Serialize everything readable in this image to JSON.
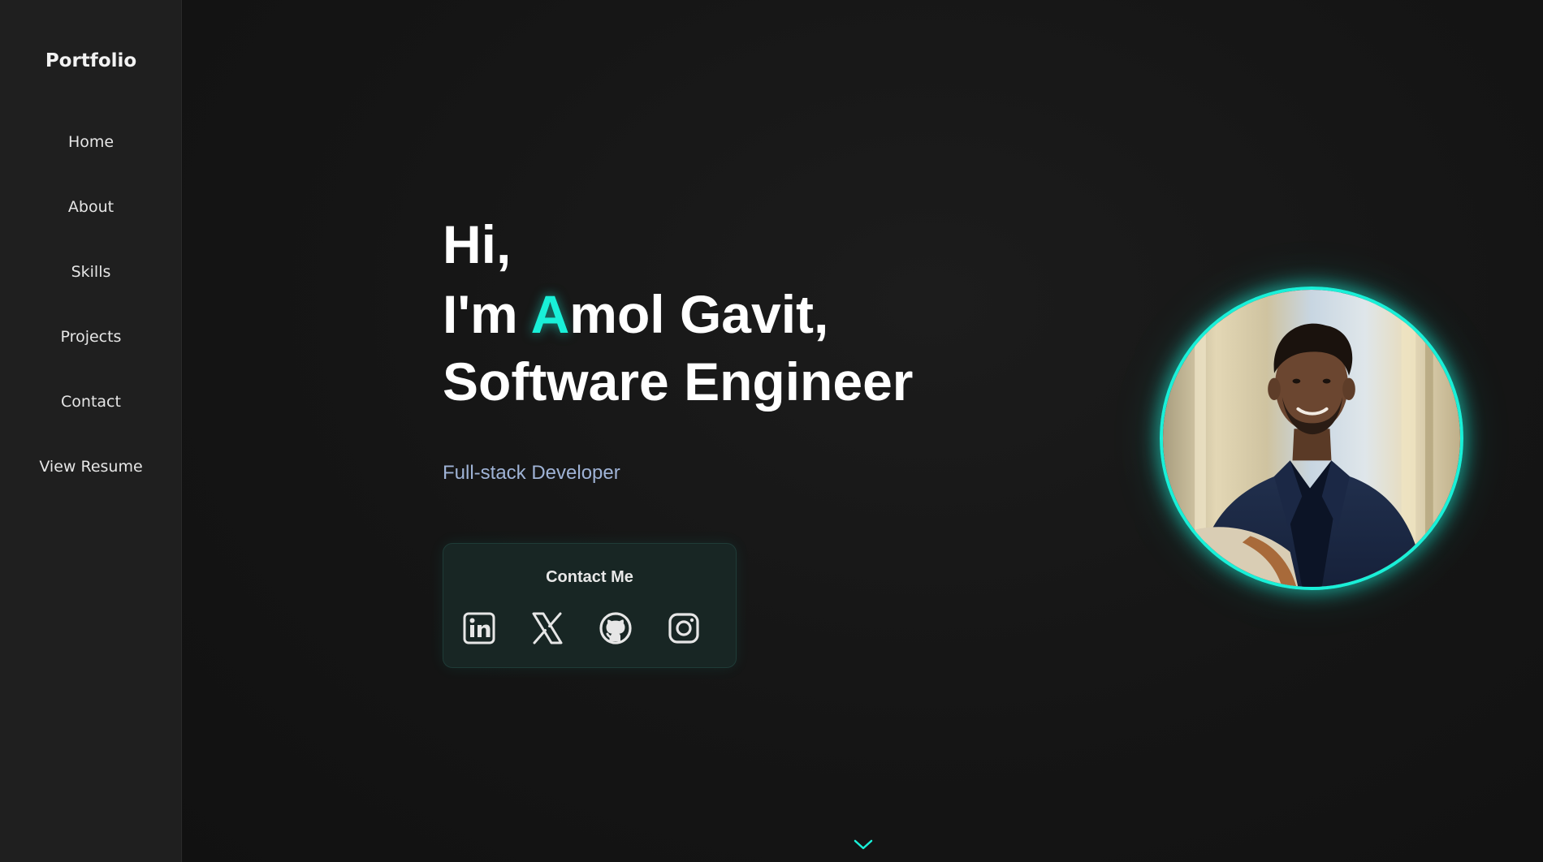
{
  "sidebar": {
    "brand": "Portfolio",
    "items": [
      {
        "label": "Home"
      },
      {
        "label": "About"
      },
      {
        "label": "Skills"
      },
      {
        "label": "Projects"
      },
      {
        "label": "Contact"
      },
      {
        "label": "View Resume"
      }
    ]
  },
  "hero": {
    "line1": "Hi,",
    "line2_prefix": "I'm ",
    "line2_accent": "A",
    "line2_rest": "mol Gavit,",
    "line3": "Software Engineer",
    "subtitle": "Full-stack Developer"
  },
  "contact": {
    "title": "Contact Me",
    "socials": [
      {
        "icon": "linkedin-icon"
      },
      {
        "icon": "x-icon"
      },
      {
        "icon": "github-icon"
      },
      {
        "icon": "instagram-icon"
      }
    ]
  },
  "colors": {
    "accent": "#19f0d8",
    "background": "#121212",
    "sidebar": "#1f1f1f",
    "subtitle": "#9fb3d6"
  },
  "icons": {
    "scroll": "chevron-down-icon",
    "profile": "profile-photo"
  }
}
